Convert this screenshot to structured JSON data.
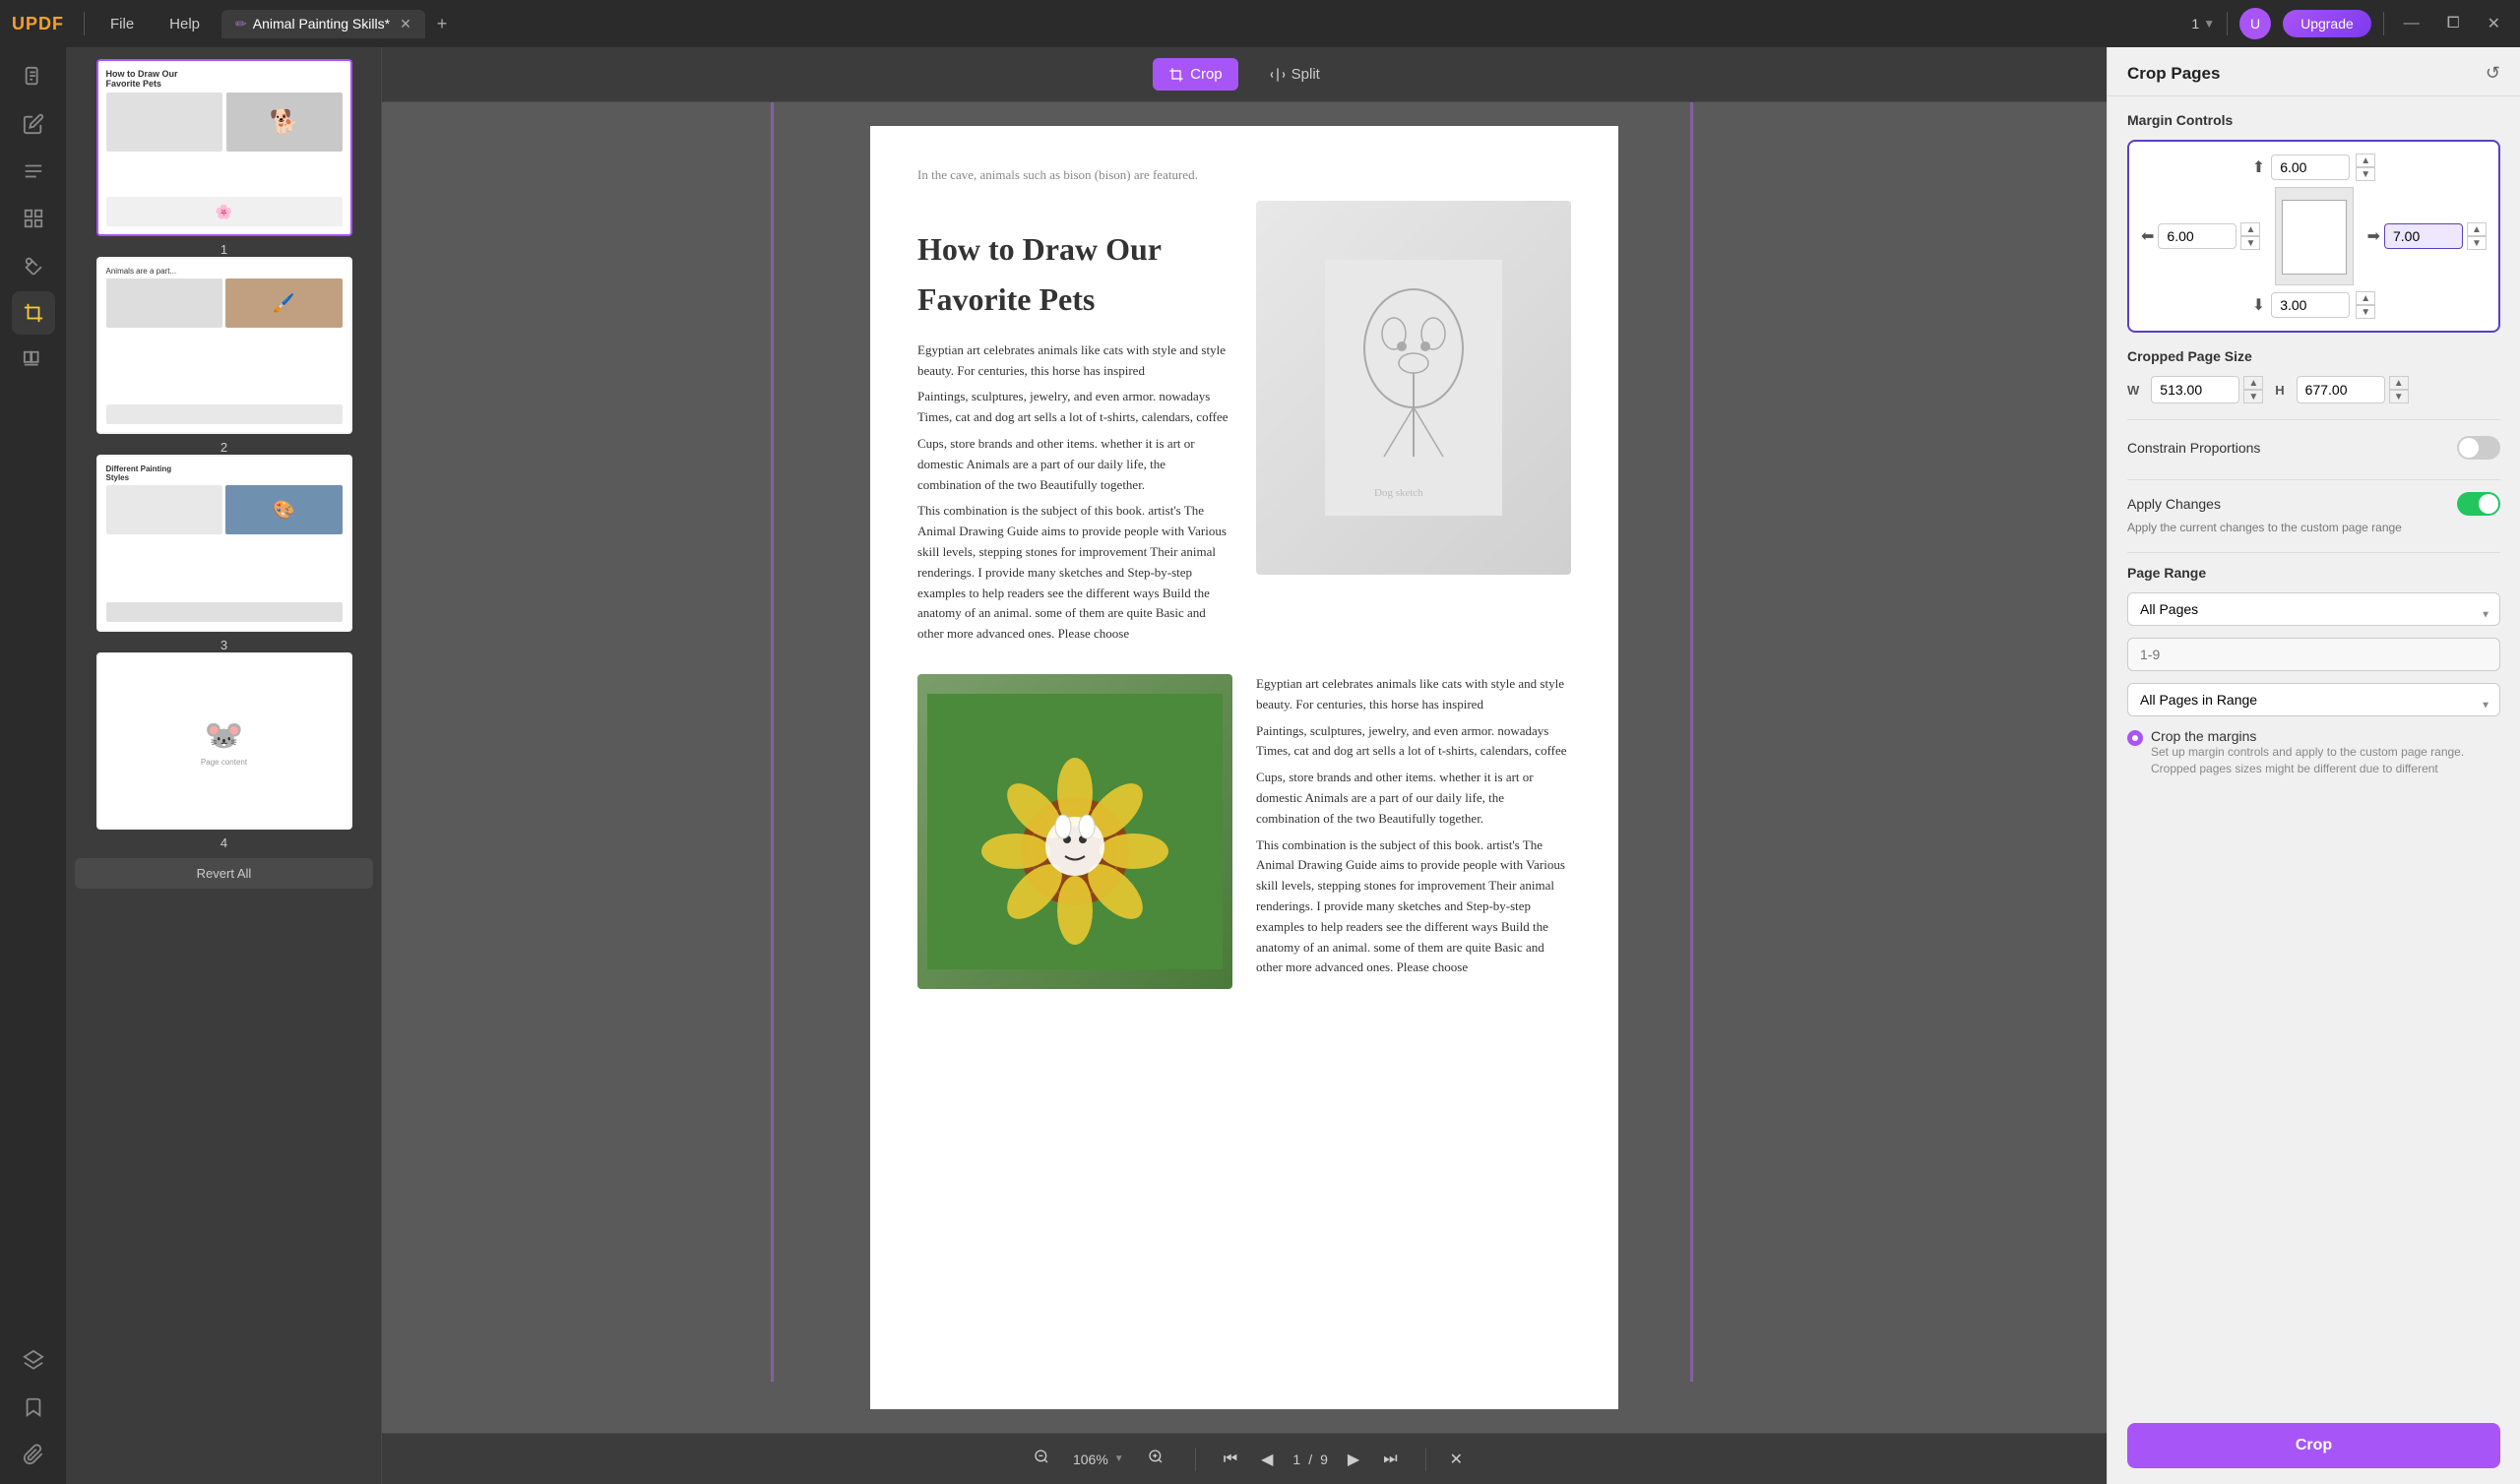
{
  "topbar": {
    "logo": "UPDF",
    "file_label": "File",
    "help_label": "Help",
    "tab_title": "Animal Painting Skills*",
    "tab_icon": "✏️",
    "add_tab_label": "+",
    "page_indicator": "1",
    "upgrade_label": "Upgrade",
    "win_minimize": "—",
    "win_maximize": "⧠",
    "win_close": "✕"
  },
  "left_sidebar": {
    "icons": [
      {
        "name": "document-icon",
        "symbol": "📄",
        "active": false
      },
      {
        "name": "edit-icon",
        "symbol": "✏️",
        "active": false
      },
      {
        "name": "list-icon",
        "symbol": "≡",
        "active": false
      },
      {
        "name": "table-icon",
        "symbol": "⊞",
        "active": false
      },
      {
        "name": "star-icon",
        "symbol": "★",
        "active": false
      },
      {
        "name": "crop-tool-icon",
        "symbol": "⊡",
        "active": true
      },
      {
        "name": "layers-icon",
        "symbol": "◫",
        "active": false
      }
    ],
    "bottom_icons": [
      {
        "name": "stack-icon",
        "symbol": "⧉"
      },
      {
        "name": "bookmark-icon",
        "symbol": "🔖"
      },
      {
        "name": "paperclip-icon",
        "symbol": "📎"
      }
    ]
  },
  "thumbnails": [
    {
      "page": "1",
      "selected": true
    },
    {
      "page": "2",
      "selected": false
    },
    {
      "page": "3",
      "selected": false
    },
    {
      "page": "4",
      "selected": false
    }
  ],
  "revert_label": "Revert All",
  "toolbar": {
    "crop_label": "Crop",
    "split_label": "Split"
  },
  "document": {
    "intro_text": "In the cave, animals such as bison (bison) are featured.",
    "heading": "How to Draw Our Favorite Pets",
    "body_paragraphs": [
      "Egyptian art celebrates animals like cats with style and style beauty. For centuries, this horse has inspired",
      "Paintings, sculptures, jewelry, and even armor. nowadays Times, cat and dog art sells a lot of t-shirts, calendars, coffee",
      "Cups, store brands and other items. whether it is art or domestic Animals are a part of our daily life, the combination of the two Beautifully together.",
      "This combination is the subject of this book. artist's The Animal Drawing Guide aims to provide people with Various skill levels, stepping stones for improvement Their animal renderings. I provide many sketches and Step-by-step examples to help readers see the different ways Build the anatomy of an animal. some of them are quite Basic and other more advanced ones. Please choose"
    ],
    "body_paragraphs2": [
      "Egyptian art celebrates animals like cats with style and style beauty. For centuries, this horse has inspired",
      "Paintings, sculptures, jewelry, and even armor. nowadays Times, cat and dog art sells a lot of t-shirts, calendars, coffee",
      "Cups, store brands and other items. whether it is art or domestic Animals are a part of our daily life, the combination of the two Beautifully together.",
      "This combination is the subject of this book. artist's The Animal Drawing Guide aims to provide people with Various skill levels, stepping stones for improvement Their animal renderings. I provide many sketches and Step-by-step examples to help readers see the different ways Build the anatomy of an animal. some of them are quite Basic and other more advanced ones. Please choose"
    ]
  },
  "bottom_toolbar": {
    "zoom_level": "106%",
    "page_current": "1",
    "page_total": "9"
  },
  "right_panel": {
    "title": "Crop Pages",
    "refresh_icon": "↺",
    "margin_controls_label": "Margin Controls",
    "margin_top_value": "6.00",
    "margin_bottom_value": "3.00",
    "margin_left_value": "6.00",
    "margin_right_value": "7.00",
    "cropped_page_size_label": "Cropped Page Size",
    "width_label": "W",
    "width_value": "513.00",
    "height_label": "H",
    "height_value": "677.00",
    "constrain_label": "Constrain Proportions",
    "apply_changes_label": "Apply Changes",
    "apply_changes_desc": "Apply the current changes to the custom page range",
    "page_range_label": "Page Range",
    "page_range_all": "All Pages",
    "page_range_input_placeholder": "1-9",
    "page_range_sub": "All Pages in Range",
    "crop_margins_label": "Crop the margins",
    "crop_margins_desc": "Set up margin controls and apply to the custom page range. Cropped pages sizes might be different due to different",
    "crop_button_label": "Crop"
  }
}
